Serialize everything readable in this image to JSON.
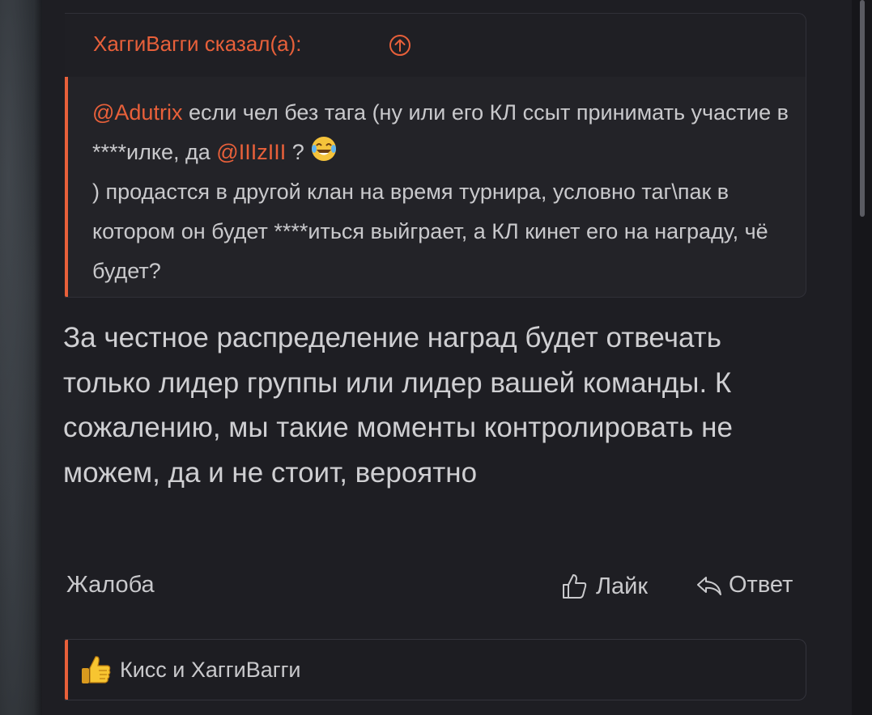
{
  "quote": {
    "author_line": "ХаггиВагги сказал(а):",
    "body_parts": {
      "mention_1": "@Adutrix",
      "text_1": " если чел без тага (ну или его КЛ ссыт принимать участие в ****илке, да ",
      "mention_2": "@IIIzIII",
      "text_2": " ? ",
      "text_3": ") продастся в другой клан на время турнира, условно таг\\пак в котором он будет ****иться выйграет, а КЛ кинет его на награду, чё будет?"
    }
  },
  "message": {
    "text": "За честное распределение наград будет отвечать только лидер группы или лидер вашей команды. К сожалению, мы такие моменты контролировать не можем, да и не стоит, вероятно"
  },
  "actions": {
    "report_label": "Жалоба",
    "like_label": "Лайк",
    "reply_label": "Ответ"
  },
  "likes": {
    "text": "Кисс и ХаггиВагги"
  },
  "icons": {
    "quote_jump": "arrow-up-circle-icon",
    "laugh": "tears-of-joy-emoji",
    "like": "thumbs-up-outline-icon",
    "reply": "reply-arrow-icon",
    "likes": "thumbs-up-emoji"
  },
  "colors": {
    "accent": "#e8603a",
    "background": "#1e1e23",
    "text": "#c9c9cc"
  }
}
